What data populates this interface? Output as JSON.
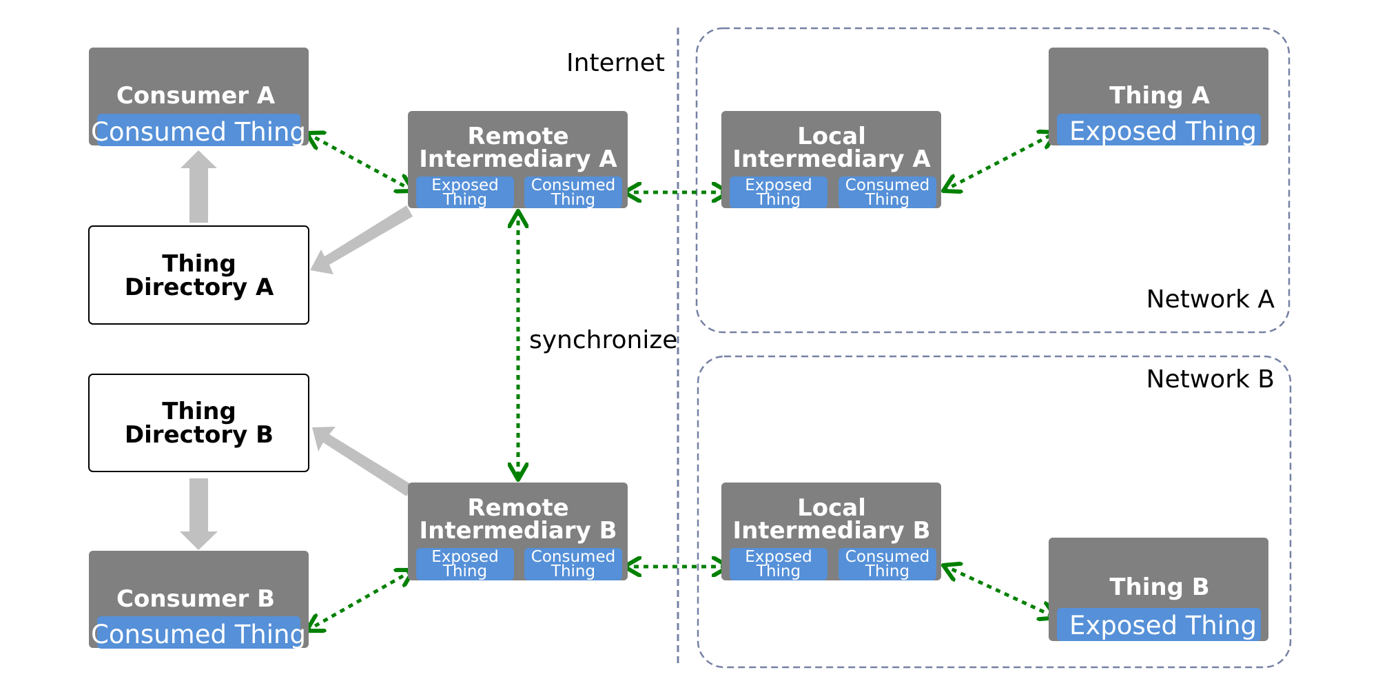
{
  "colors": {
    "node_fill": "#808080",
    "sub_fill": "#5590d8",
    "text_light": "#ffffff",
    "text_dark": "#000000",
    "link_green": "#008000",
    "gray_arrow": "#c0c0c0",
    "boundary": "#7580a3",
    "directory_fill": "#ffffff",
    "directory_stroke": "#000000"
  },
  "zones": {
    "internet_label": "Internet",
    "network_a_label": "Network A",
    "network_b_label": "Network B"
  },
  "nodes": {
    "consumer_a": {
      "title": "Consumer A",
      "sub": "Consumed Thing"
    },
    "consumer_b": {
      "title": "Consumer B",
      "sub": "Consumed Thing"
    },
    "directory_a": {
      "line1": "Thing",
      "line2": "Directory A"
    },
    "directory_b": {
      "line1": "Thing",
      "line2": "Directory B"
    },
    "remote_a": {
      "line1": "Remote",
      "line2": "Intermediary A",
      "exposed": [
        "Exposed",
        "Thing"
      ],
      "consumed": [
        "Consumed",
        "Thing"
      ]
    },
    "remote_b": {
      "line1": "Remote",
      "line2": "Intermediary B",
      "exposed": [
        "Exposed",
        "Thing"
      ],
      "consumed": [
        "Consumed",
        "Thing"
      ]
    },
    "local_a": {
      "line1": "Local",
      "line2": "Intermediary A",
      "exposed": [
        "Exposed",
        "Thing"
      ],
      "consumed": [
        "Consumed",
        "Thing"
      ]
    },
    "local_b": {
      "line1": "Local",
      "line2": "Intermediary B",
      "exposed": [
        "Exposed",
        "Thing"
      ],
      "consumed": [
        "Consumed",
        "Thing"
      ]
    },
    "thing_a": {
      "title": "Thing A",
      "sub": "Exposed Thing"
    },
    "thing_b": {
      "title": "Thing B",
      "sub": "Exposed Thing"
    }
  },
  "edge_labels": {
    "sync": "synchronize"
  }
}
